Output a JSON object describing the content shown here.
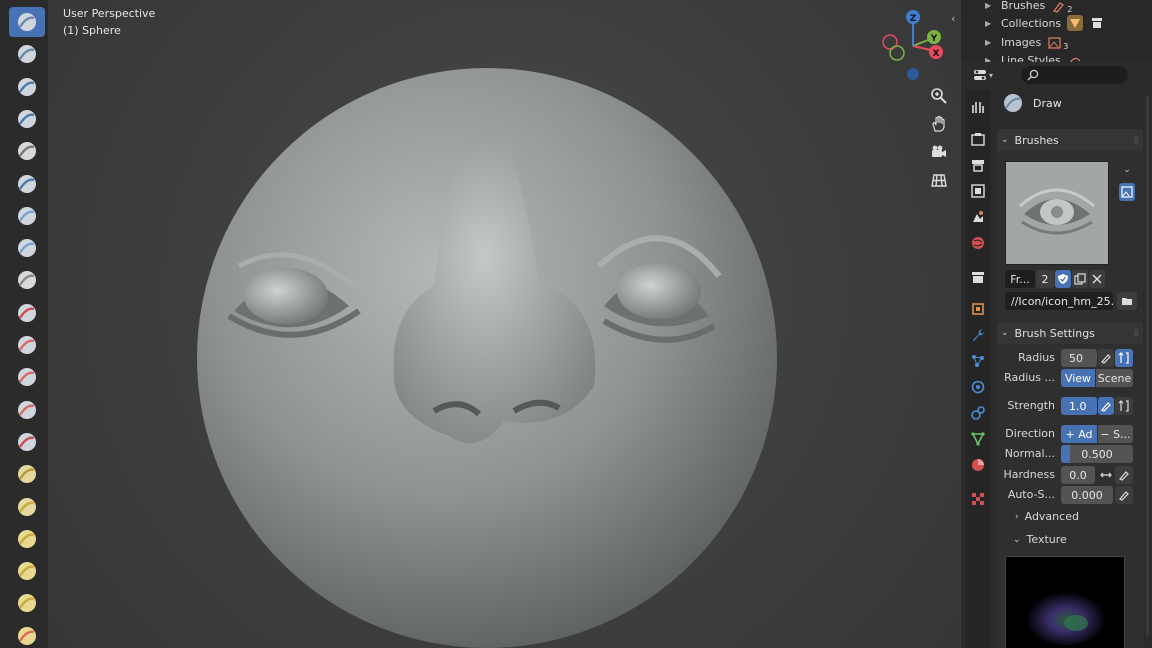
{
  "viewport": {
    "perspective_label": "User Perspective",
    "object_label": "(1) Sphere",
    "gizmo_axes": {
      "z": "Z",
      "y": "Y",
      "x": "X"
    },
    "nav_icons": [
      "zoom-icon",
      "pan-hand-icon",
      "camera-view-icon",
      "grid-view-icon"
    ]
  },
  "toolshelf": {
    "tools": [
      "draw",
      "draw-sharp",
      "clay",
      "clay-strips",
      "clay-thumb",
      "layer",
      "inflate",
      "blob",
      "crease",
      "smooth",
      "flatten",
      "fill",
      "scrape",
      "multiplane-scrape",
      "pinch",
      "grab",
      "elastic-deform",
      "snake-hook",
      "thumb",
      "pose"
    ],
    "active_index": 0
  },
  "outliner": {
    "items": [
      {
        "label": "Brushes",
        "count": "2"
      },
      {
        "label": "Collections",
        "count": ""
      },
      {
        "label": "Images",
        "count": "3"
      },
      {
        "label": "Line Styles",
        "count": ""
      }
    ]
  },
  "properties": {
    "search_placeholder": "",
    "tool_name": "Draw",
    "brushes_panel": {
      "title": "Brushes",
      "brush_name": "Fr...",
      "users_count": "2",
      "filepath": "//Icon/icon_hm_25..."
    },
    "brush_settings": {
      "title": "Brush Settings",
      "radius_label": "Radius",
      "radius_value": "50",
      "radius_unit_label": "Radius ...",
      "radius_unit_view": "View",
      "radius_unit_scene": "Scene",
      "strength_label": "Strength",
      "strength_value": "1.0",
      "direction_label": "Direction",
      "direction_add": "+ Ad",
      "direction_sub": "− S...",
      "normal_label": "Normal...",
      "normal_value": "0.500",
      "normal_fraction": 0.5,
      "hardness_label": "Hardness",
      "hardness_value": "0.0",
      "autosmooth_label": "Auto-S...",
      "autosmooth_value": "0.000"
    },
    "advanced_title": "Advanced",
    "texture_title": "Texture"
  },
  "colors": {
    "accent": "#4772b3",
    "axis_x": "#e84a5f",
    "axis_y": "#7cb342",
    "axis_z": "#3f7fd1"
  }
}
